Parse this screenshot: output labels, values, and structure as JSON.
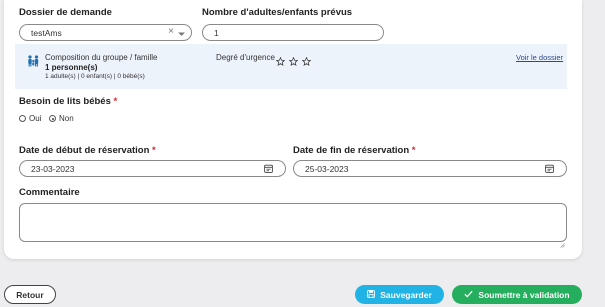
{
  "dossier": {
    "label": "Dossier de demande",
    "value": "testAms",
    "clear_icon": "×",
    "dropdown_icon": "chevron-down-icon"
  },
  "nombre": {
    "label": "Nombre d'adultes/enfants prévus",
    "value": "1"
  },
  "info": {
    "family_icon": "family-icon",
    "composition_title": "Composition du groupe / famille",
    "composition_count": "1 personne(s)",
    "composition_detail": "1 adulte(s) | 0 enfant(s) | 0 bébé(s)",
    "urgency_label": "Degré d'urgence",
    "urgency_stars": 0,
    "urgency_max": 3,
    "view_link": "Voir le dossier"
  },
  "lits": {
    "label": "Besoin de lits bébés",
    "required_mark": "*",
    "options": [
      {
        "label": "Oui",
        "selected": false
      },
      {
        "label": "Non",
        "selected": true
      }
    ]
  },
  "date_debut": {
    "label": "Date de début de réservation",
    "required_mark": "*",
    "value": "23-03-2023"
  },
  "date_fin": {
    "label": "Date de fin de réservation",
    "required_mark": "*",
    "value": "25-03-2023"
  },
  "commentaire": {
    "label": "Commentaire",
    "value": ""
  },
  "footer": {
    "back_label": "Retour",
    "save_label": "Sauvegarder",
    "submit_label": "Soumettre à validation"
  },
  "colors": {
    "save_button": "#22b3e6",
    "submit_button": "#26ae5f",
    "info_background": "#edf3fb",
    "link": "#2b4a8c"
  }
}
